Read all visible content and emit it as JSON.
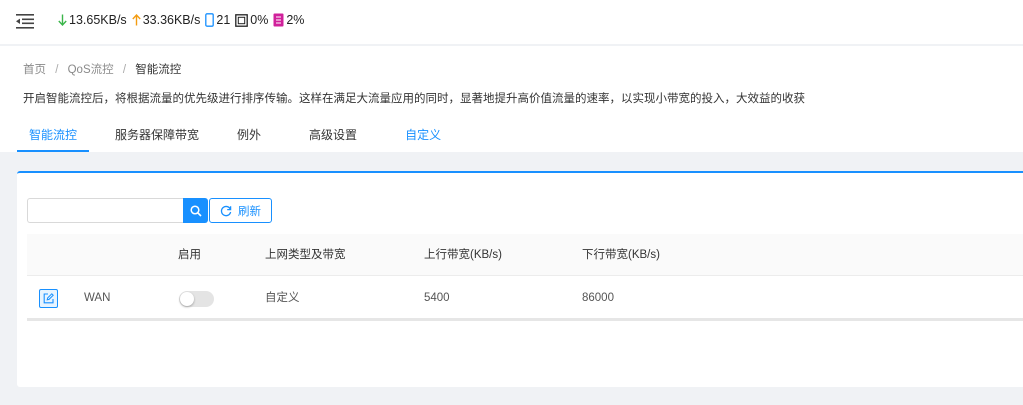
{
  "topbar": {
    "download_speed": "13.65KB/s",
    "upload_speed": "33.36KB/s",
    "devices": "21",
    "cpu": "0%",
    "memory": "2%",
    "icons": {
      "menu": "menu-fold-icon",
      "download": "arrow-down-icon",
      "upload": "arrow-up-icon",
      "devices": "mobile-icon",
      "cpu": "cpu-icon",
      "memory": "memory-icon"
    },
    "colors": {
      "download": "#3bb54a",
      "upload": "#f39c12",
      "devices": "#1890ff",
      "memory": "#d0219b"
    }
  },
  "breadcrumb": {
    "home": "首页",
    "section": "QoS流控",
    "current": "智能流控",
    "separator": "/"
  },
  "description": "开启智能流控后，将根据流量的优先级进行排序传输。这样在满足大流量应用的同时，显著地提升高价值流量的速率，以实现小带宽的投入，大效益的收获",
  "tabs": [
    {
      "label": "智能流控",
      "active": true
    },
    {
      "label": "服务器保障带宽"
    },
    {
      "label": "例外"
    },
    {
      "label": "高级设置"
    },
    {
      "label": "自定义"
    }
  ],
  "toolbar": {
    "search_placeholder": "",
    "refresh_label": "刷新"
  },
  "table": {
    "headers": {
      "enable": "启用",
      "type": "上网类型及带宽",
      "upload": "上行带宽(KB/s)",
      "download": "下行带宽(KB/s)"
    },
    "rows": [
      {
        "name": "WAN",
        "enabled": false,
        "type": "自定义",
        "upload": "5400",
        "download": "86000"
      }
    ]
  },
  "accent_color": "#1890ff"
}
